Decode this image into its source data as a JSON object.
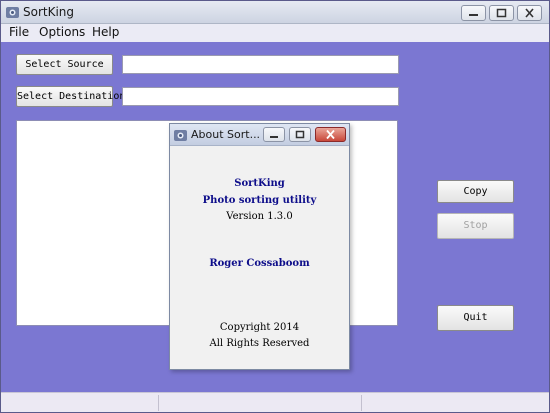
{
  "window": {
    "title": "SortKing",
    "icons": {
      "app": "app-logo-icon",
      "minimize": "minimize-icon",
      "maximize": "maximize-icon",
      "close": "close-icon"
    }
  },
  "menu": {
    "file": "File",
    "options": "Options",
    "help": "Help"
  },
  "main": {
    "select_source_label": "Select Source",
    "select_destination_label": "Select Destination",
    "source_path": "",
    "destination_path": "",
    "copy_label": "Copy",
    "stop_label": "Stop",
    "quit_label": "Quit"
  },
  "about": {
    "title": "About Sort...",
    "app_name": "SortKing",
    "tagline": "Photo sorting utility",
    "version": "Version 1.3.0",
    "author": "Roger Cossaboom",
    "copyright": "Copyright 2014",
    "rights": "All Rights Reserved"
  },
  "colors": {
    "client_background": "#7b77d2",
    "dialog_text_blue": "#0d0d8a",
    "close_button_red": "#c8473a"
  }
}
